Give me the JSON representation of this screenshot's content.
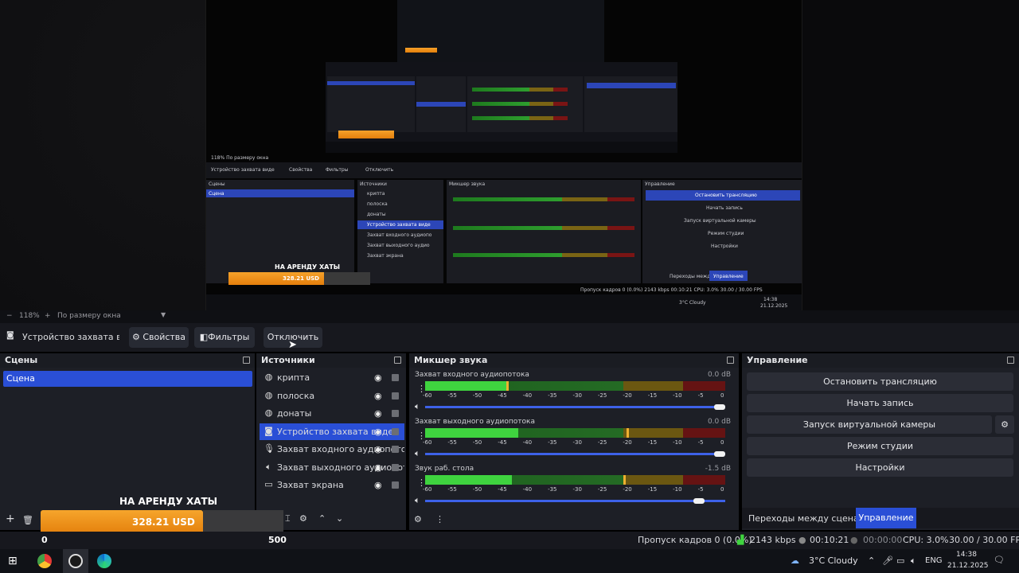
{
  "preview": {
    "title": "НА АРЕНДУ ХАТЫ",
    "amount": "328.21 USD",
    "scale_min": "0",
    "scale_max": "500",
    "nested_labels": {
      "tab": "Устройство захвата виде",
      "props": "Свойства",
      "filters": "Фильтры",
      "disconnect": "Отключить",
      "scenes": "Сцены",
      "scene": "Сцена",
      "sources": "Источники",
      "mixer": "Микшер звука",
      "control": "Управление",
      "stop": "Остановить трансляцию",
      "record": "Начать запись",
      "vcam": "Запуск виртуальной камеры",
      "studio": "Режим студии",
      "settings": "Настройки",
      "transitions": "Переходы между сценами",
      "control_tab": "Управление",
      "items": [
        "крипта",
        "полоска",
        "донаты",
        "Устройство захвата виде",
        "Захват входного аудиопо",
        "Захват выходного аудио",
        "Захват экрана"
      ],
      "status": "Пропуск кадров 0 (0.0%)",
      "kbps": "2143 kbps",
      "time": "00:10:21",
      "cpu": "CPU: 3.0%",
      "fps": "30.00 / 30.00 FPS",
      "weather": "3°C Cloudy",
      "clock": "14:38",
      "date": "21.12.2025",
      "zoom": "118%",
      "fit": "По размеру окна"
    }
  },
  "zoombar": {
    "zoom": "118%",
    "fit": "По размеру окна"
  },
  "source_toolbar": {
    "device": "Устройство захвата виде",
    "properties": "Свойства",
    "filters": "Фильтры",
    "disconnect": "Отключить"
  },
  "scenes": {
    "title": "Сцены",
    "items": [
      "Сцена"
    ]
  },
  "sources": {
    "title": "Источники",
    "items": [
      {
        "label": "крипта",
        "icon": "globe-icon"
      },
      {
        "label": "полоска",
        "icon": "globe-icon"
      },
      {
        "label": "донаты",
        "icon": "globe-icon"
      },
      {
        "label": "Устройство захвата видео",
        "icon": "camera-icon"
      },
      {
        "label": "Захват входного аудиопотока",
        "icon": "microphone-icon"
      },
      {
        "label": "Захват выходного аудиопотока",
        "icon": "speaker-icon"
      },
      {
        "label": "Захват экрана",
        "icon": "monitor-icon"
      }
    ]
  },
  "mixer": {
    "title": "Микшер звука",
    "channels": [
      {
        "name": "Захват входного аудиопотока",
        "db": "0.0 dB",
        "level": 0.27,
        "peak": 0.27,
        "volume": 1.0
      },
      {
        "name": "Захват выходного аудиопотока",
        "db": "0.0 dB",
        "level": 0.31,
        "peak": 0.67,
        "volume": 1.0
      },
      {
        "name": "Звук раб. стола",
        "db": "-1.5 dB",
        "level": 0.29,
        "peak": 0.66,
        "volume": 0.93
      }
    ],
    "ticks": [
      "-60",
      "-55",
      "-50",
      "-45",
      "-40",
      "-35",
      "-30",
      "-25",
      "-20",
      "-15",
      "-10",
      "-5",
      "0"
    ]
  },
  "controls": {
    "title": "Управление",
    "stop_stream": "Остановить трансляцию",
    "start_record": "Начать запись",
    "virtual_camera": "Запуск виртуальной камеры",
    "studio_mode": "Режим студии",
    "settings": "Настройки"
  },
  "bottom_tabs": {
    "transitions": "Переходы между сценами",
    "controls": "Управление"
  },
  "status": {
    "dropped": "Пропуск кадров 0 (0.0%)",
    "bitrate": "2143 kbps",
    "live_time": "00:10:21",
    "rec_time": "00:00:00",
    "cpu": "CPU: 3.0%",
    "fps": "30.00 / 30.00 FPS"
  },
  "taskbar": {
    "weather": "3°C Cloudy",
    "lang": "ENG",
    "time": "14:38",
    "date": "21.12.2025"
  },
  "colors": {
    "accent": "#2a4fd6",
    "orange": "#f29a20",
    "panel": "#1d1f26"
  }
}
